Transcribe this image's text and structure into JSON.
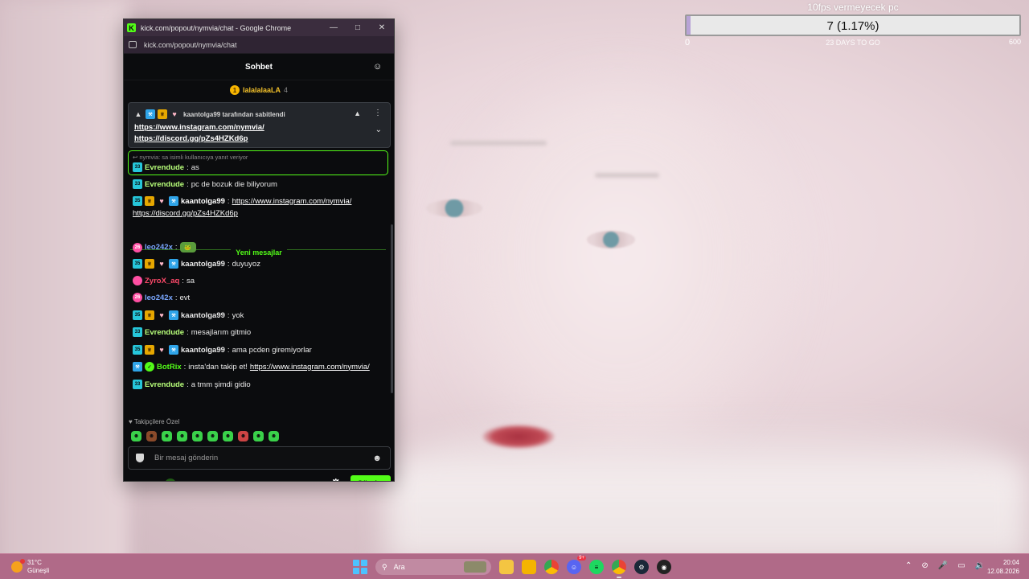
{
  "overlay": {
    "title": "10fps vermeyecek pc",
    "value_text": "7 (1.17%)",
    "progress_fraction": 0.0117,
    "min_label": "0",
    "max_label": "600",
    "subtitle": "23 DAYS TO GO"
  },
  "window": {
    "title": "kick.com/popout/nymvia/chat - Google Chrome",
    "url": "kick.com/popout/nymvia/chat",
    "minimize_icon": "minimize-icon",
    "maximize_icon": "maximize-icon",
    "close_icon": "close-icon"
  },
  "chat": {
    "header_title": "Sohbet",
    "top_gifter": {
      "rank": "1",
      "name": "lalalalaaLA",
      "count": "4"
    },
    "pinned": {
      "pinned_by": "kaantolga99 tarafından sabitlendi",
      "link1": "https://www.instagram.com/nymvia/",
      "link2": "https://discord.gg/pZs4HZKd6p"
    },
    "reply": {
      "context": "nymvia: sa isimli kullanıcıya yanıt veriyor",
      "user": "Evrendude",
      "text": "as"
    },
    "messages_before": [
      {
        "user": "Evrendude",
        "text": "pc de bozuk die biliyorum"
      },
      {
        "user": "kaantolga99",
        "link": "https://www.instagram.com/nymvia/",
        "link2": "https://discord.gg/pZs4HZKd6p"
      }
    ],
    "new_messages_label": "Yeni mesajlar",
    "messages": [
      {
        "user": "leo242x",
        "text": ""
      },
      {
        "user": "kaantolga99",
        "text": "duyuyoz"
      },
      {
        "user": "ZyroX_aq",
        "text": "sa"
      },
      {
        "user": "leo242x",
        "text": "evt"
      },
      {
        "user": "kaantolga99",
        "text": "yok"
      },
      {
        "user": "Evrendude",
        "text": "mesajlarım gitmio"
      },
      {
        "user": "kaantolga99",
        "text": "ama pcden giremiyorlar"
      },
      {
        "user": "BotRix",
        "text": "insta'dan takip et!",
        "link": "https://www.instagram.com/nymvia/"
      },
      {
        "user": "Evrendude",
        "text": "a tmm şimdi gidio"
      }
    ],
    "followers_only_label": "Takipçilere Özel",
    "input_placeholder": "Bir mesaj gönderin",
    "send_label": "Gönder",
    "sub_badge": "33",
    "sub_badge_alt": "35",
    "pink_badge": "26"
  },
  "colors": {
    "kick_green": "#53fc18",
    "evrendude": "#b8ff7a",
    "kaantolga": "#ffffff",
    "leo": "#7aa7ff",
    "zyrox": "#ff4a6a",
    "botrix": "#53fc18",
    "gifter": "#f3c12a"
  },
  "taskbar": {
    "weather_temp": "31°C",
    "weather_desc": "Güneşli",
    "search_label": "Ara",
    "discord_badge": "9+",
    "time": "20:04",
    "date": "12.08.2026"
  }
}
